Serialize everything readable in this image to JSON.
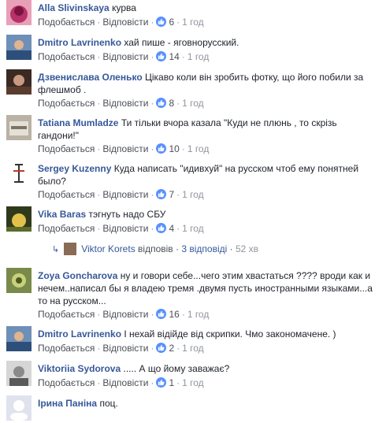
{
  "actions": {
    "like": "Подобається",
    "reply": "Відповісти",
    "sep": "·",
    "time": "1 год"
  },
  "comments": [
    {
      "author": "Alla Slivinskaya",
      "text": "курва",
      "likes": "6"
    },
    {
      "author": "Dmitro Lavrinenko",
      "text": "хай пише - яговнорусский.",
      "likes": "14"
    },
    {
      "author": "Дзвенислава Оленько",
      "text": "Цікаво коли він зробить фотку, що його побили за флешмоб .",
      "likes": "8"
    },
    {
      "author": "Tatiana Mumladze",
      "text": "Ти тільки вчора казала \"Куди не плюнь , то скрізь гандони!\"",
      "likes": "10"
    },
    {
      "author": "Sergey Kuzenny",
      "text": "Куда написать \"идивхуй\" на русском чтоб ему понятней было?",
      "likes": "7"
    },
    {
      "author": "Vika Baras",
      "text": "тэгнуть надо СБУ",
      "likes": "4"
    },
    {
      "author": "Zoya Goncharova",
      "text": "ну и говори себе...чего этим хвастаться ???? вроди как и нечем..написал бы я владею тремя .двумя пусть иностранными языками...а то на русском...",
      "likes": "16"
    },
    {
      "author": "Dmitro Lavrinenko",
      "text": "І нехай відійде від скрипки. Чмо закономачене. )",
      "likes": "2"
    },
    {
      "author": "Viktoriia Sydorova",
      "text": "..... А що йому заважає?",
      "likes": "1"
    },
    {
      "author": "Ірина Паніна",
      "text": "поц."
    }
  ],
  "reply_thread": {
    "name": "Viktor Korets",
    "verb": "відповів",
    "sep": "·",
    "count": "3 відповіді",
    "time": "52 хв"
  },
  "colors": {
    "author": "#365899",
    "like_badge": "#5890ff",
    "meta": "#90949c"
  }
}
